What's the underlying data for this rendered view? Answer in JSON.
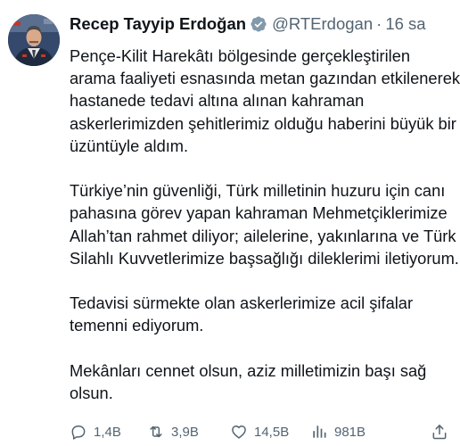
{
  "user": {
    "display_name": "Recep Tayyip Erdoğan",
    "handle": "@RTErdogan",
    "separator": "·",
    "time": "16 sa",
    "verified_badge_color": "#829aab",
    "avatar_icon": "profile-photo"
  },
  "tweet": {
    "paragraphs": [
      "Pençe-Kilit Harekâtı bölgesinde gerçekleştirilen arama faaliyeti esnasında metan gazından etkilenerek hastanede tedavi altına alınan kahraman askerlerimizden şehitlerimiz olduğu haberini büyük bir üzüntüyle aldım.",
      "Türkiye’nin güvenliği, Türk milletinin huzuru için canı pahasına görev yapan kahraman Mehmetçiklerimize Allah’tan rahmet diliyor; ailelerine, yakınlarına ve Türk Silahlı Kuvvetlerimize başsağlığı dileklerimi iletiyorum.",
      "Tedavisi sürmekte olan askerlerimize acil şifalar temenni ediyorum.",
      "Mekânları cennet olsun, aziz milletimizin başı sağ olsun."
    ]
  },
  "actions": {
    "reply_count": "1,4B",
    "retweet_count": "3,9B",
    "like_count": "14,5B",
    "view_count": "981B",
    "icon_color": "#536471",
    "icons": [
      "reply-icon",
      "retweet-icon",
      "like-icon",
      "views-icon",
      "share-icon"
    ]
  }
}
